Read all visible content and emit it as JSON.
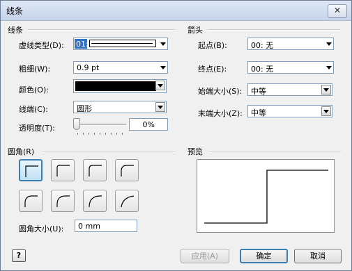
{
  "window": {
    "title": "线条",
    "close_glyph": "✕"
  },
  "line": {
    "section_title": "线条",
    "dash_label": "虚线类型(D):",
    "dash_value": "01:",
    "weight_label": "粗细(W):",
    "weight_value": "0.9 pt",
    "color_label": "颜色(O):",
    "color_value": "#000000",
    "cap_label": "线端(C):",
    "cap_value": "圆形",
    "transparency_label": "透明度(T):",
    "transparency_value": "0%"
  },
  "arrows": {
    "section_title": "箭头",
    "begin_label": "起点(B):",
    "begin_value": "00: 无",
    "end_label": "终点(E):",
    "end_value": "00: 无",
    "begin_size_label": "始端大小(S):",
    "begin_size_value": "中等",
    "end_size_label": "末端大小(Z):",
    "end_size_value": "中等"
  },
  "corners": {
    "section_title": "圆角(R)",
    "size_label": "圆角大小(U):",
    "size_value": "0 mm"
  },
  "preview": {
    "section_title": "预览"
  },
  "footer": {
    "help_glyph": "?",
    "apply_label": "应用(A)",
    "ok_label": "确定",
    "cancel_label": "取消"
  }
}
